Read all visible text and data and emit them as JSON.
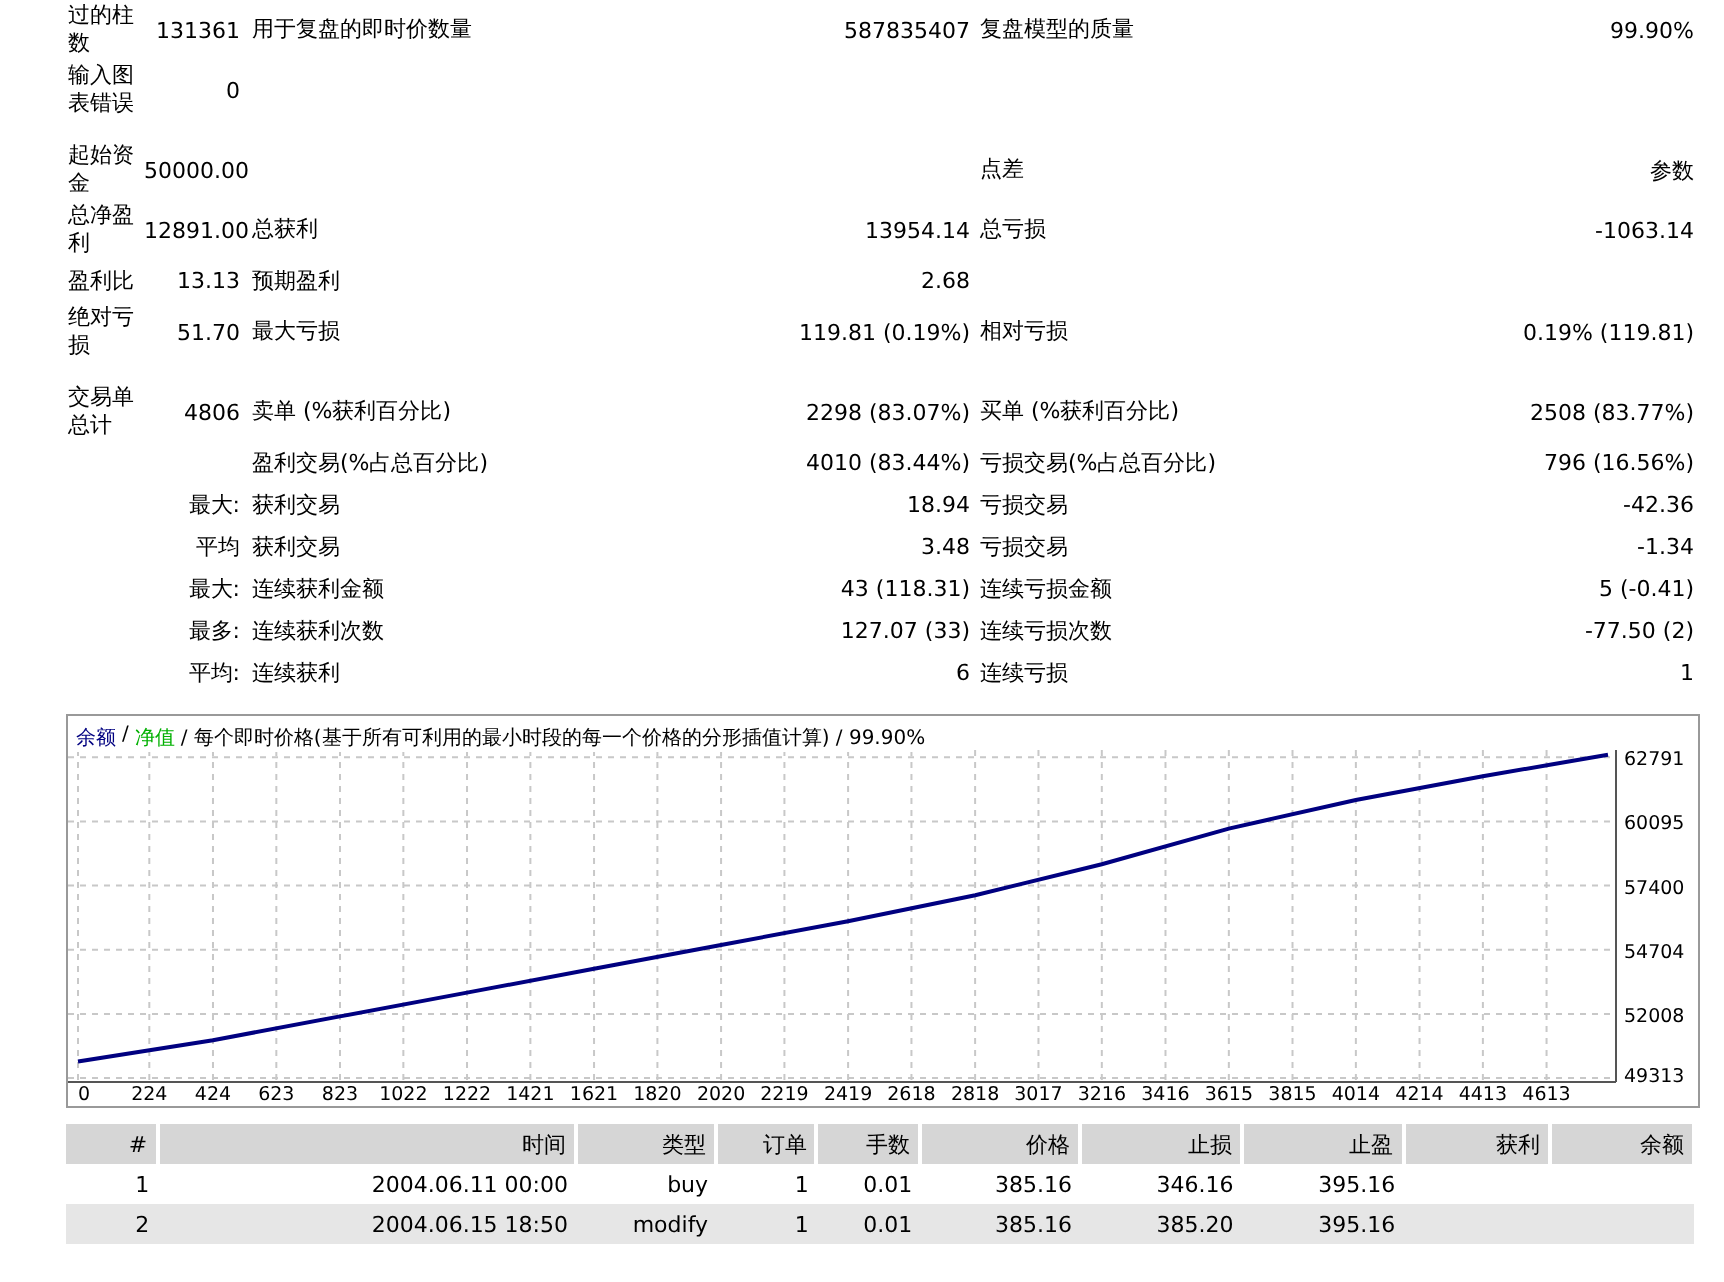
{
  "stats": [
    [
      {
        "cells": [
          "过的柱数",
          "131361",
          "用于复盘的即时价数量",
          "587835407",
          "复盘模型的质量",
          "99.90%"
        ]
      },
      {
        "cells": [
          "输入图表错误",
          "0",
          "",
          "",
          "",
          ""
        ]
      }
    ],
    [
      {
        "cells": [
          "起始资金",
          "50000.00",
          "",
          "",
          "点差",
          "参数"
        ]
      },
      {
        "cells": [
          "总净盈利",
          "12891.00",
          "总获利",
          "13954.14",
          "总亏损",
          "-1063.14"
        ]
      },
      {
        "cells": [
          "盈利比",
          "13.13",
          "预期盈利",
          "2.68",
          "",
          ""
        ]
      },
      {
        "cells": [
          "绝对亏损",
          "51.70",
          "最大亏损",
          "119.81 (0.19%)",
          "相对亏损",
          "0.19% (119.81)"
        ]
      }
    ],
    [
      {
        "cells": [
          "交易单总计",
          "4806",
          "卖单 (%获利百分比)",
          "2298 (83.07%)",
          "买单 (%获利百分比)",
          "2508 (83.77%)"
        ]
      },
      {
        "cells": [
          "",
          "",
          "盈利交易(%占总百分比)",
          "4010 (83.44%)",
          "亏损交易(%占总百分比)",
          "796 (16.56%)"
        ]
      },
      {
        "cells": [
          "",
          "最大:",
          "获利交易",
          "18.94",
          "亏损交易",
          "-42.36"
        ]
      },
      {
        "cells": [
          "",
          "平均",
          "获利交易",
          "3.48",
          "亏损交易",
          "-1.34"
        ]
      },
      {
        "cells": [
          "",
          "最大:",
          "连续获利金额",
          "43 (118.31)",
          "连续亏损金额",
          "5 (-0.41)"
        ]
      },
      {
        "cells": [
          "",
          "最多:",
          "连续获利次数",
          "127.07 (33)",
          "连续亏损次数",
          "-77.50 (2)"
        ]
      },
      {
        "cells": [
          "",
          "平均:",
          "连续获利",
          "6",
          "连续亏损",
          "1"
        ]
      }
    ]
  ],
  "chart": {
    "legend": [
      {
        "text": "/",
        "color": "#000000"
      },
      {
        "text": "净值",
        "color": "#00b000"
      },
      {
        "text": "/ 每个即时价格(基于所有可利用的最小时段的每一个价格的分形插值计算) / 99.90%",
        "color": "#000000"
      }
    ],
    "chart_data": {
      "type": "line",
      "x": [
        0,
        424,
        823,
        1222,
        1621,
        2020,
        2419,
        2818,
        3216,
        3615,
        4014,
        4413,
        4806
      ],
      "series": [
        {
          "name": "余额",
          "color": "#000080",
          "values": [
            50000,
            50900,
            51900,
            52900,
            53900,
            54900,
            55900,
            57000,
            58300,
            59800,
            61000,
            62000,
            62900
          ]
        }
      ],
      "xlim": [
        0,
        4806
      ],
      "ylim": [
        49313,
        63100
      ],
      "grid": true,
      "xticks": [
        0,
        224,
        424,
        623,
        823,
        1022,
        1222,
        1421,
        1621,
        1820,
        2020,
        2219,
        2419,
        2618,
        2818,
        3017,
        3216,
        3416,
        3615,
        3815,
        4014,
        4214,
        4413,
        4613
      ],
      "yticks": [
        49313,
        52008,
        54704,
        57400,
        60095,
        62791
      ]
    }
  },
  "trades": {
    "columns": [
      "#",
      "时间",
      "类型",
      "订单",
      "手数",
      "价格",
      "止损",
      "止盈",
      "获利",
      "余额"
    ],
    "rows": [
      [
        "1",
        "2004.06.11 00:00",
        "buy",
        "1",
        "0.01",
        "385.16",
        "346.16",
        "395.16"
      ],
      [
        "2",
        "2004.06.15 18:50",
        "modify",
        "1",
        "0.01",
        "385.16",
        "385.20",
        "395.16"
      ]
    ]
  }
}
